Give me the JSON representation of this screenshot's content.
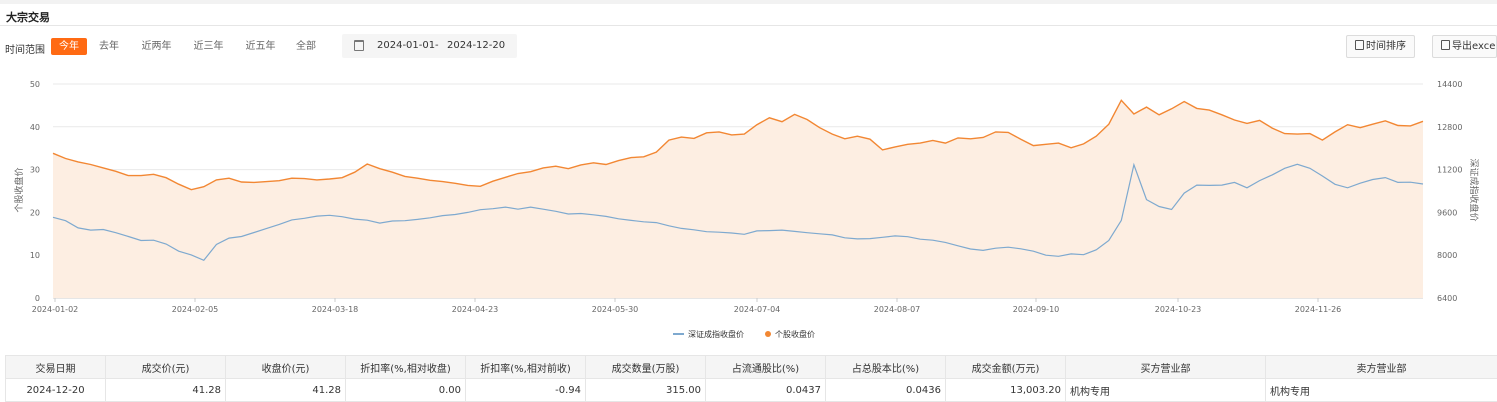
{
  "page": {
    "title": "大宗交易"
  },
  "filters": {
    "range_label": "时间范围",
    "ranges": [
      "今年",
      "去年",
      "近两年",
      "近三年",
      "近五年",
      "全部"
    ],
    "active_range": "今年",
    "date_start": "2024-01-01",
    "date_sep": "-",
    "date_end": "2024-12-20"
  },
  "toolbar": {
    "sort_label": "时间排序",
    "export_label": "导出excel"
  },
  "chart_data": {
    "type": "line",
    "x_ticks": [
      "2024-01-02",
      "2024-02-05",
      "2024-03-18",
      "2024-04-23",
      "2024-05-30",
      "2024-07-04",
      "2024-08-07",
      "2024-09-10",
      "2024-10-23",
      "2024-11-26"
    ],
    "left_axis": {
      "label": "个股收盘价",
      "ticks": [
        "0",
        "10",
        "20",
        "30",
        "40",
        "50"
      ],
      "range": [
        0,
        50
      ]
    },
    "right_axis": {
      "label": "深证成指收盘价",
      "ticks": [
        "6400",
        "8000",
        "9600",
        "11200",
        "12800",
        "14400"
      ],
      "range": [
        6400,
        14400
      ]
    },
    "legend": [
      {
        "name": "深证成指收盘价",
        "color": "#7ea9cf"
      },
      {
        "name": "个股收盘价",
        "color": "#f28733"
      }
    ],
    "grid": true,
    "series": [
      {
        "name": "个股收盘价",
        "axis": "left",
        "color": "#f28733",
        "values": [
          33.8,
          32.6,
          31.8,
          31.2,
          30.4,
          29.6,
          28.6,
          28.6,
          28.9,
          28.1,
          26.6,
          25.3,
          26.0,
          27.6,
          28.0,
          27.1,
          27.0,
          27.2,
          27.4,
          28.0,
          27.9,
          27.6,
          27.8,
          28.1,
          29.4,
          31.3,
          30.2,
          29.4,
          28.4,
          28.0,
          27.5,
          27.2,
          26.8,
          26.3,
          26.1,
          27.3,
          28.2,
          29.1,
          29.5,
          30.4,
          30.8,
          30.2,
          31.1,
          31.6,
          31.2,
          32.1,
          32.8,
          33.0,
          34.1,
          36.9,
          37.6,
          37.3,
          38.6,
          38.8,
          38.1,
          38.3,
          40.5,
          42.1,
          41.2,
          42.9,
          41.7,
          39.8,
          38.3,
          37.2,
          37.8,
          37.1,
          34.6,
          35.3,
          35.9,
          36.2,
          36.8,
          36.2,
          37.4,
          37.2,
          37.5,
          38.8,
          38.7,
          37.1,
          35.6,
          35.9,
          36.2,
          35.1,
          36.0,
          37.8,
          40.6,
          46.2,
          43.0,
          44.6,
          42.8,
          44.2,
          45.9,
          44.3,
          43.9,
          42.8,
          41.6,
          40.8,
          41.5,
          39.7,
          38.4,
          38.3,
          38.4,
          36.9,
          38.8,
          40.5,
          39.8,
          40.6,
          41.4,
          40.3,
          40.2,
          41.28
        ]
      },
      {
        "name": "深证成指收盘价",
        "axis": "right",
        "color": "#7ea9cf",
        "values": [
          9418,
          9290,
          9020,
          8940,
          8960,
          8840,
          8700,
          8550,
          8560,
          8420,
          8150,
          8010,
          7810,
          8400,
          8640,
          8700,
          8850,
          9000,
          9150,
          9320,
          9380,
          9460,
          9490,
          9440,
          9350,
          9310,
          9200,
          9280,
          9290,
          9340,
          9400,
          9480,
          9520,
          9600,
          9700,
          9740,
          9800,
          9720,
          9800,
          9720,
          9640,
          9540,
          9560,
          9510,
          9450,
          9360,
          9300,
          9250,
          9220,
          9100,
          9000,
          8950,
          8880,
          8860,
          8830,
          8780,
          8910,
          8920,
          8940,
          8890,
          8840,
          8800,
          8760,
          8650,
          8610,
          8620,
          8670,
          8720,
          8690,
          8600,
          8560,
          8480,
          8350,
          8230,
          8180,
          8260,
          8300,
          8240,
          8150,
          8000,
          7960,
          8050,
          8020,
          8200,
          8550,
          9300,
          11380,
          10080,
          9820,
          9710,
          10320,
          10620,
          10610,
          10620,
          10720,
          10520,
          10790,
          11000,
          11250,
          11400,
          11250,
          10960,
          10650,
          10520,
          10690,
          10830,
          10900,
          10720,
          10730,
          10660
        ]
      }
    ]
  },
  "table": {
    "headers": [
      "交易日期",
      "成交价(元)",
      "收盘价(元)",
      "折扣率(%,相对收盘)",
      "折扣率(%,相对前收)",
      "成交数量(万股)",
      "占流通股比(%)",
      "占总股本比(%)",
      "成交金额(万元)",
      "买方营业部",
      "卖方营业部"
    ],
    "rows": [
      [
        "2024-12-20",
        "41.28",
        "41.28",
        "0.00",
        "-0.94",
        "315.00",
        "0.0437",
        "0.0436",
        "13,003.20",
        "机构专用",
        "机构专用"
      ]
    ]
  }
}
